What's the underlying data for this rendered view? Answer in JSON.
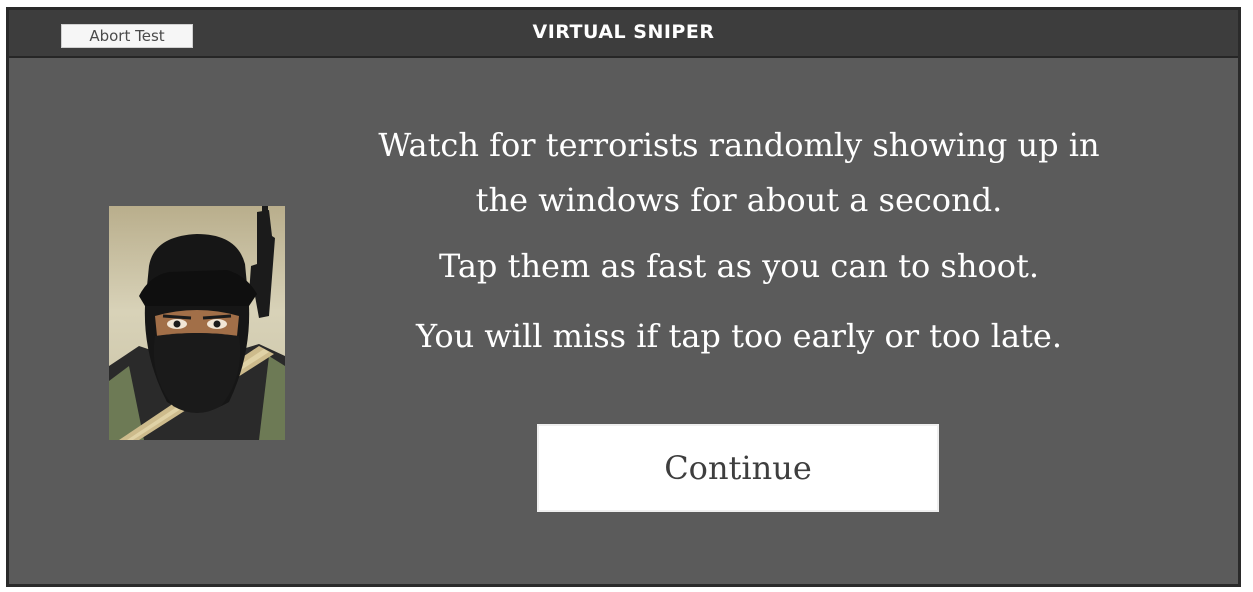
{
  "header": {
    "abort_label": "Abort Test",
    "title": "VIRTUAL SNIPER"
  },
  "main": {
    "instruction_1": "Watch for terrorists randomly showing up in the windows for about a second.",
    "instruction_2": "Tap them as fast as you can to shoot.",
    "instruction_3": "You will miss if tap too early or too late.",
    "continue_label": "Continue"
  },
  "icons": {
    "portrait": "masked-terrorist-with-rifle-illustration"
  },
  "colors": {
    "background": "#5b5b5b",
    "titlebar": "#3d3d3d",
    "text": "#ffffff",
    "button": "#ffffff",
    "button_text": "#3e3e3e"
  }
}
